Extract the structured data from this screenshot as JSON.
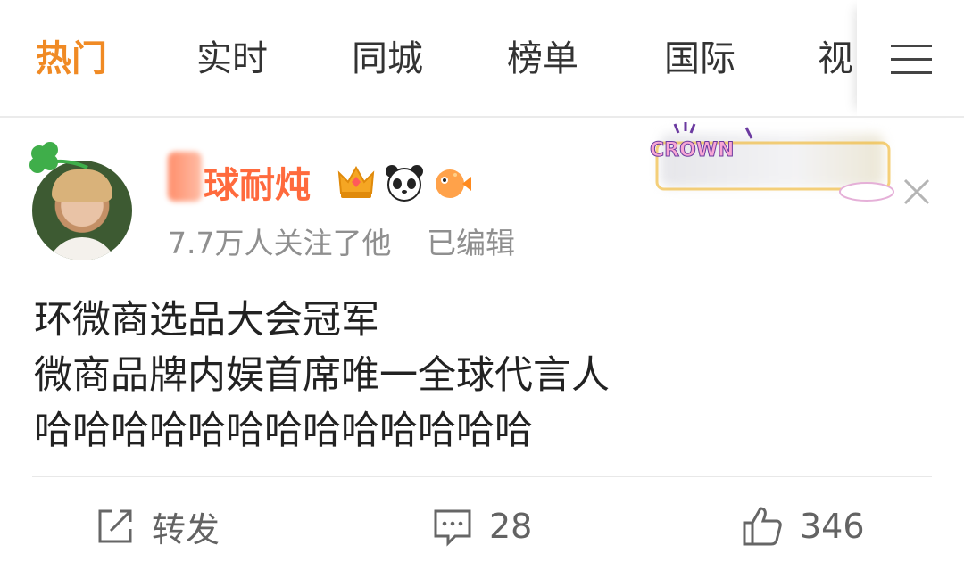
{
  "tabs": [
    {
      "label": "热门",
      "active": true
    },
    {
      "label": "实时",
      "active": false
    },
    {
      "label": "同城",
      "active": false
    },
    {
      "label": "榜单",
      "active": false
    },
    {
      "label": "国际",
      "active": false
    },
    {
      "label": "视",
      "active": false
    }
  ],
  "menu_icon": "hamburger-icon",
  "post": {
    "author": {
      "name_visible": "球耐炖",
      "badges": [
        "crown-badge-icon",
        "panda-badge-icon",
        "pufferfish-badge-icon"
      ],
      "followers": "7.7万人关注了他",
      "edited": "已编辑"
    },
    "decoration": {
      "crown_text": "CROWN"
    },
    "text_lines": [
      "环微商选品大会冠军",
      "微商品牌内娱首席唯一全球代言人",
      "哈哈哈哈哈哈哈哈哈哈哈哈哈"
    ],
    "actions": {
      "repost_label": "转发",
      "comment_count": "28",
      "like_count": "346"
    }
  },
  "colors": {
    "active_tab": "#f08a24",
    "username": "#ff6a3d",
    "muted_text": "#8f8f8f",
    "body_text": "#222222"
  }
}
